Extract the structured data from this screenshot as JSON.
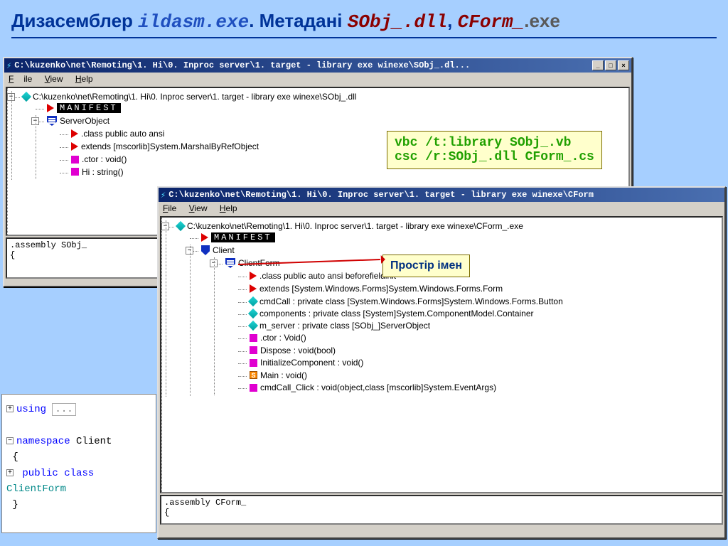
{
  "slide": {
    "t1": "Дизасемблер ",
    "t2": "ildasm.exe",
    "t3": ". Метадані ",
    "t4": "SObj_.dll",
    "t5": ", ",
    "t6": "CForm_",
    "t7": ".exe"
  },
  "menu": {
    "file": "File",
    "view": "View",
    "help": "Help"
  },
  "winbtn": {
    "min": "_",
    "max": "□",
    "close": "×"
  },
  "win1": {
    "title": "C:\\kuzenko\\net\\Remoting\\1. Hi\\0. Inproc server\\1. target -  library exe winexe\\SObj_.dl...",
    "root": "C:\\kuzenko\\net\\Remoting\\1. Hi\\0. Inproc server\\1. target -  library exe winexe\\SObj_.dll",
    "manifest": "MANIFEST",
    "ns": "ServerObject",
    "items": [
      ".class public auto ansi",
      " extends [mscorlib]System.MarshalByRefObject",
      ".ctor : void()",
      " Hi : string()"
    ],
    "asm1": ".assembly SObj_",
    "asm2": "{"
  },
  "win2": {
    "title": "C:\\kuzenko\\net\\Remoting\\1. Hi\\0. Inproc server\\1. target -  library exe winexe\\CForm",
    "root": "C:\\kuzenko\\net\\Remoting\\1. Hi\\0. Inproc server\\1. target -  library exe winexe\\CForm_.exe",
    "manifest": "MANIFEST",
    "ns": "Client",
    "cls": "ClientForm",
    "items": [
      ".class public auto ansi beforefieldinit",
      " extends [System.Windows.Forms]System.Windows.Forms.Form",
      "cmdCall : private class [System.Windows.Forms]System.Windows.Forms.Button",
      "components : private class [System]System.ComponentModel.Container",
      "m_server : private class [SObj_]ServerObject",
      ".ctor : Void()",
      " Dispose : void(bool)",
      " InitializeComponent : void()",
      " Main : void()",
      " cmdCall_Click : void(object,class [mscorlib]System.EventArgs)"
    ],
    "asm1": ".assembly CForm_",
    "asm2": "{"
  },
  "callout_cmd": {
    "l1": "vbc /t:library SObj_.vb",
    "l2": "csc /r:SObj_.dll CForm_.cs"
  },
  "callout_ns": "Простір імен",
  "code": {
    "l1a": "using",
    "l1b": "...",
    "l2a": "namespace",
    "l2b": " Client",
    "l3": "{",
    "l4a": "public",
    "l4b": "class",
    "l4c": " ClientForm",
    "l5": "}"
  }
}
